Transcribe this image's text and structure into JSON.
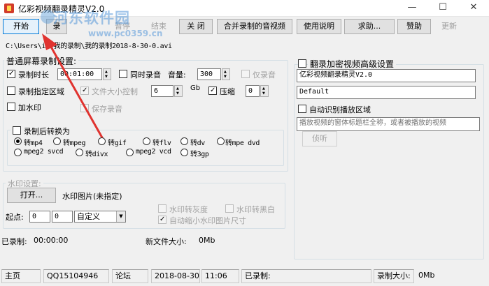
{
  "window": {
    "title": "亿彩视频翻录精灵V2.0",
    "minimize_glyph": "—",
    "maximize_glyph": "☐",
    "close_glyph": "✕"
  },
  "watermark": {
    "text": "河东软件园",
    "url": "www.pc0359.cn"
  },
  "toolbar": {
    "start": "开始",
    "record": "录",
    "pause": "暂停",
    "end": "结束",
    "close": "关 闭",
    "merge": "合并录制的音视频",
    "manual": "使用说明",
    "help": "求助...",
    "donate": "赞助",
    "update": "更新"
  },
  "path": "C:\\Users\\ic\\我的录制\\我的录制2018-8-30-0.avi",
  "normal_settings": {
    "title": "普通屏幕录制设置:",
    "duration_label": "录制时长",
    "duration_checked": true,
    "duration_value": "00:01:00",
    "record_audio_label": "同时录音",
    "record_audio_checked": false,
    "volume_label": "音量:",
    "volume_value": "300",
    "audio_only_label": "仅录音",
    "audio_only_checked": false,
    "area_label": "录制指定区域",
    "area_checked": false,
    "filesize_label": "文件大小控制",
    "filesize_checked": true,
    "filesize_value": "6",
    "filesize_unit": "Gb",
    "compress_label": "压缩",
    "compress_checked": true,
    "compress_value": "0",
    "watermark_label": "加水印",
    "watermark_checked": false,
    "save_audio_label": "保存录音",
    "save_audio_checked": false
  },
  "convert": {
    "title": "录制后转换为",
    "checked": false,
    "options": [
      "转mp4",
      "转mpeg",
      "转gif",
      "转flv",
      "转dv",
      "转mpe dvd",
      "mpeg2 svcd",
      "转divx",
      "mpeg2 vcd",
      "转3gp"
    ],
    "selected_index": 0
  },
  "watermark_settings": {
    "title": "水印设置:",
    "open_button": "打开...",
    "image_label": "水印图片(未指定)",
    "origin_label": "起点:",
    "origin_x": "0",
    "origin_y": "0",
    "mode_value": "自定义",
    "gray_label": "水印转灰度",
    "bw_label": "水印转黑白",
    "shrink_label": "自动缩小水印图片尺寸",
    "shrink_checked": true
  },
  "advanced": {
    "title": "翻录加密视频高级设置",
    "checked": false,
    "name_value": "亿彩视频翻录精灵V2.0",
    "profile_value": "Default",
    "auto_detect_label": "自动识别播放区域",
    "auto_detect_checked": false,
    "window_title_placeholder": "播放视频的窗体标题栏全称，或者被播放的视频",
    "sniff_button": "侦听"
  },
  "progress": {
    "recorded_label": "已录制:",
    "recorded_value": "00:00:00",
    "newsize_label": "新文件大小:",
    "newsize_value": "0Mb"
  },
  "statusbar": {
    "home": "主页",
    "qq": "QQ15104946",
    "forum": "论坛",
    "date": "2018-08-30",
    "time": "11:06",
    "recorded": "已录制:",
    "recorded_size": "录制大小:",
    "size_value": "0Mb"
  },
  "colors": {
    "annotation_arrow": "#e0332f",
    "watermark": "#5698d8",
    "focus_border": "#0078d7"
  }
}
